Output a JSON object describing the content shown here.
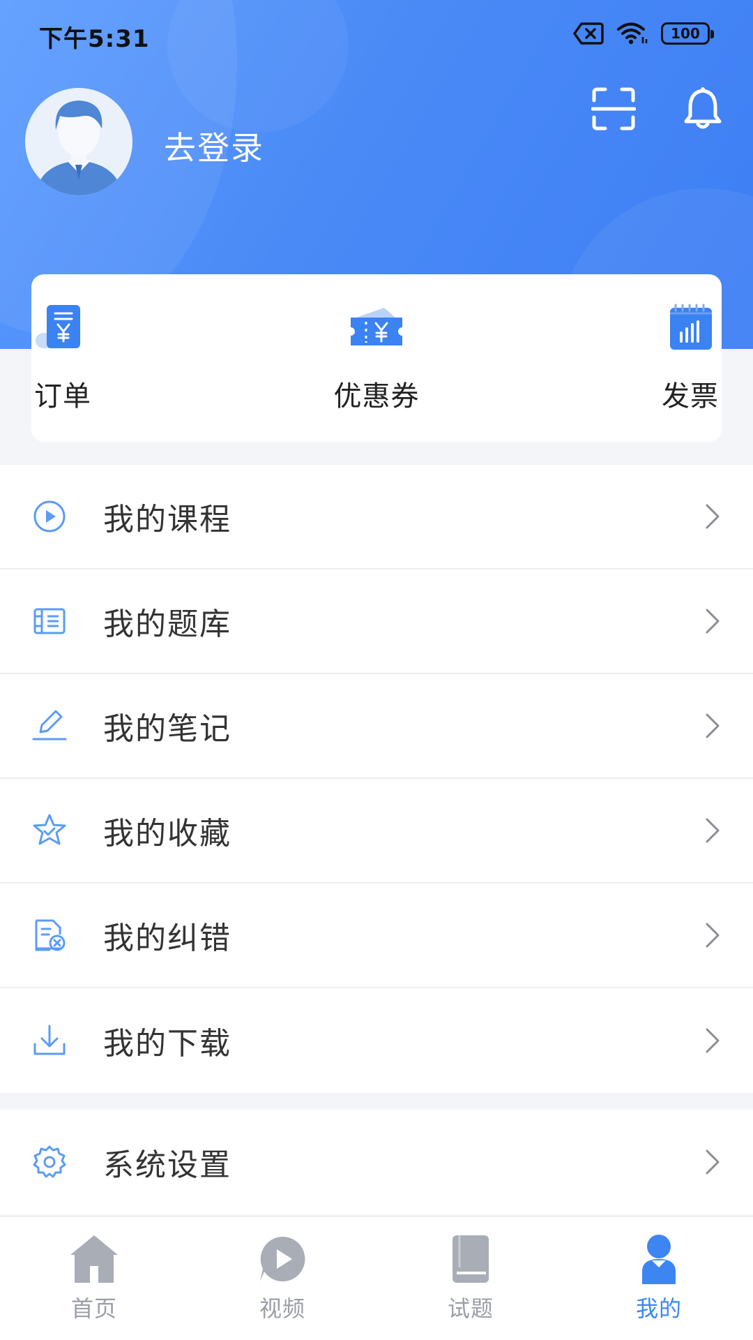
{
  "status_bar": {
    "time": "下午5:31",
    "battery": "100"
  },
  "profile": {
    "login_label": "去登录"
  },
  "quick_actions": [
    {
      "label": "订单",
      "icon": "order-receipt-icon"
    },
    {
      "label": "优惠券",
      "icon": "coupon-icon"
    },
    {
      "label": "发票",
      "icon": "invoice-icon"
    }
  ],
  "menu": [
    {
      "label": "我的课程",
      "icon": "play-circle-icon"
    },
    {
      "label": "我的题库",
      "icon": "question-bank-icon"
    },
    {
      "label": "我的笔记",
      "icon": "pencil-icon"
    },
    {
      "label": "我的收藏",
      "icon": "star-icon"
    },
    {
      "label": "我的纠错",
      "icon": "error-report-icon"
    },
    {
      "label": "我的下载",
      "icon": "download-icon"
    }
  ],
  "settings_menu": [
    {
      "label": "系统设置",
      "icon": "gear-icon"
    }
  ],
  "tabs": [
    {
      "label": "首页",
      "icon": "home-icon",
      "active": false
    },
    {
      "label": "视频",
      "icon": "video-icon",
      "active": false
    },
    {
      "label": "试题",
      "icon": "book-icon",
      "active": false
    },
    {
      "label": "我的",
      "icon": "user-icon",
      "active": true
    }
  ],
  "colors": {
    "header_blue": "#4a8af6",
    "accent_blue": "#3d86f2",
    "icon_blue": "#5b9bf5",
    "tab_inactive": "#9a9ea6",
    "page_background": "#f3f5f9"
  }
}
